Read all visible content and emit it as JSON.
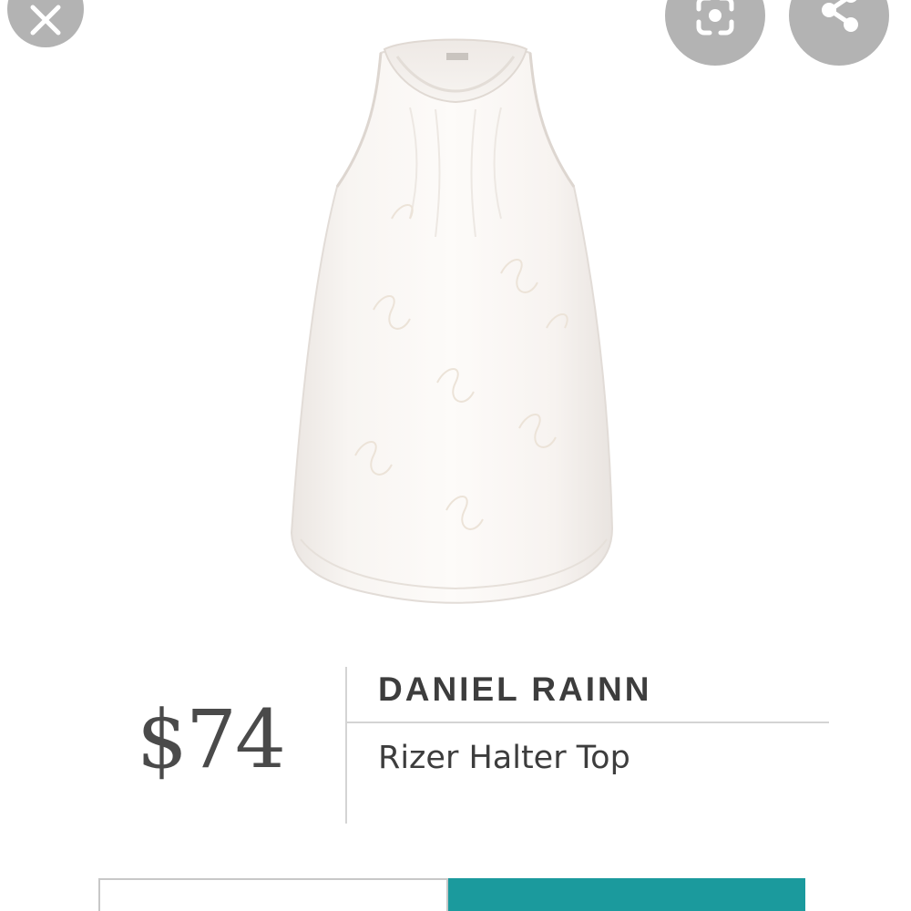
{
  "colors": {
    "accent": "#1b9a9d",
    "overlay_button": "#b3b3b3",
    "text": "#3d3d3d",
    "price_text": "#4a4a4a"
  },
  "icons": {
    "close": "close-icon",
    "lens": "lens-search-icon",
    "share": "share-icon"
  },
  "product": {
    "price": "$74",
    "brand": "DANIEL RAINN",
    "name": "Rizer Halter Top"
  }
}
